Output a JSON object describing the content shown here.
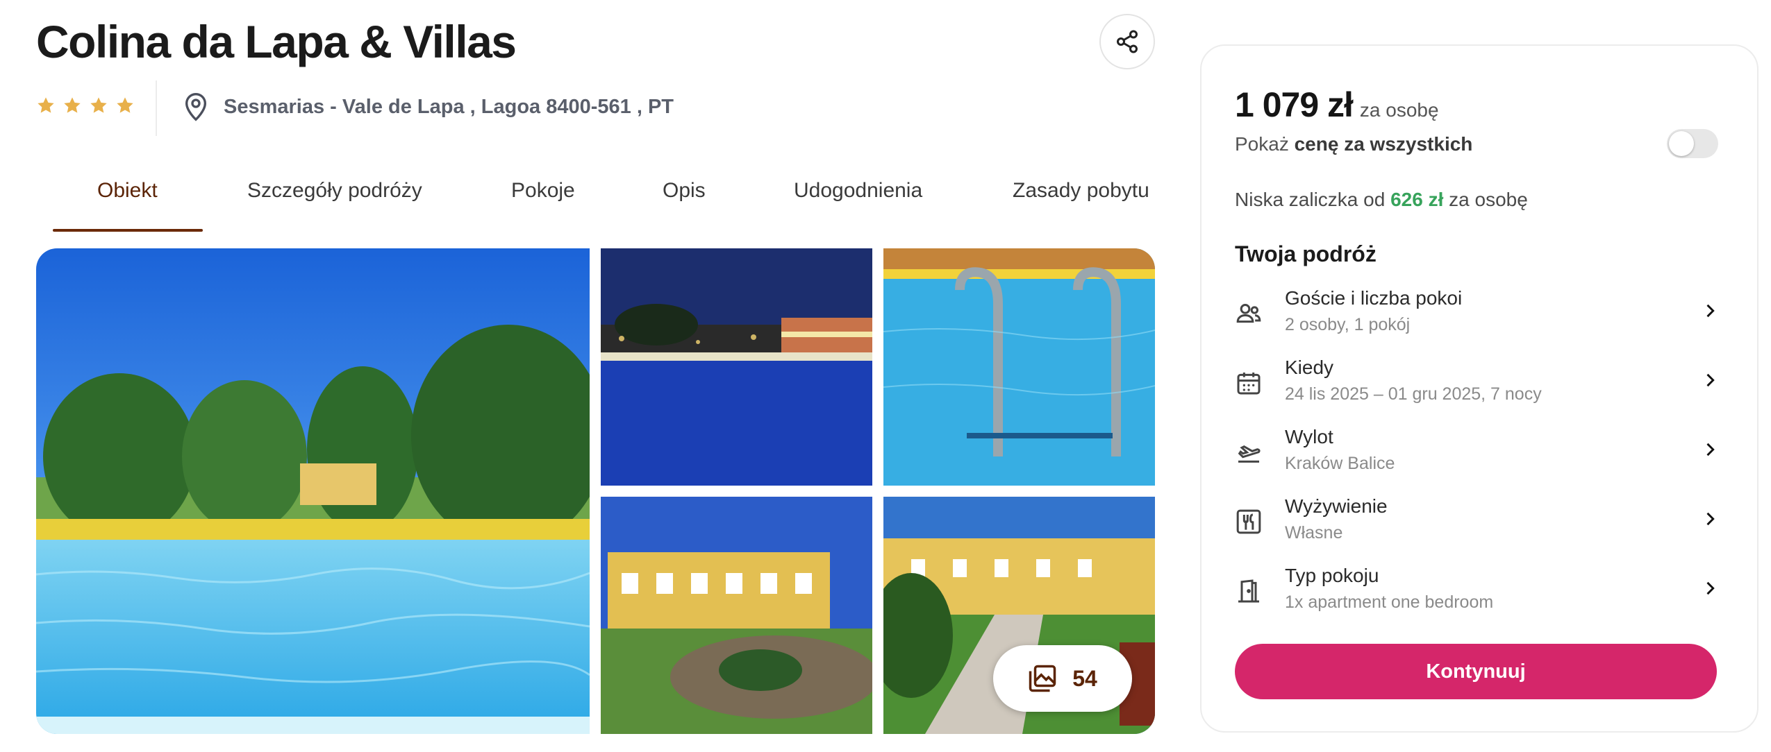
{
  "hotel": {
    "name": "Colina da Lapa & Villas",
    "stars": 4,
    "address": "Sesmarias - Vale de Lapa , Lagoa 8400-561 , PT"
  },
  "tabs": [
    {
      "label": "Obiekt",
      "active": true
    },
    {
      "label": "Szczegóły podróży",
      "active": false
    },
    {
      "label": "Pokoje",
      "active": false
    },
    {
      "label": "Opis",
      "active": false
    },
    {
      "label": "Udogodnienia",
      "active": false
    },
    {
      "label": "Zasady pobytu",
      "active": false
    }
  ],
  "gallery": {
    "photo_count": "54"
  },
  "booking": {
    "price": "1 079 zł",
    "price_suffix": "za osobę",
    "show_all_prefix": "Pokaż ",
    "show_all_bold": "cenę za wszystkich",
    "toggle_on": false,
    "deposit_prefix": "Niska zaliczka od",
    "deposit_amount": "626 zł",
    "deposit_suffix": "za osobę",
    "trip_title": "Twoja podróż",
    "items": [
      {
        "label": "Goście i liczba pokoi",
        "value": "2 osoby, 1 pokój",
        "icon": "guests-icon"
      },
      {
        "label": "Kiedy",
        "value": "24 lis 2025 – 01 gru 2025, 7 nocy",
        "icon": "calendar-icon"
      },
      {
        "label": "Wylot",
        "value": "Kraków Balice",
        "icon": "plane-departure-icon"
      },
      {
        "label": "Wyżywienie",
        "value": "Własne",
        "icon": "cutlery-icon"
      },
      {
        "label": "Typ pokoju",
        "value": "1x apartment one bedroom",
        "icon": "door-icon"
      }
    ],
    "continue_label": "Kontynuuj"
  },
  "colors": {
    "accent": "#d5266a",
    "tab_active": "#5b2407",
    "deposit": "#37a35b",
    "star": "#e8b04a"
  }
}
